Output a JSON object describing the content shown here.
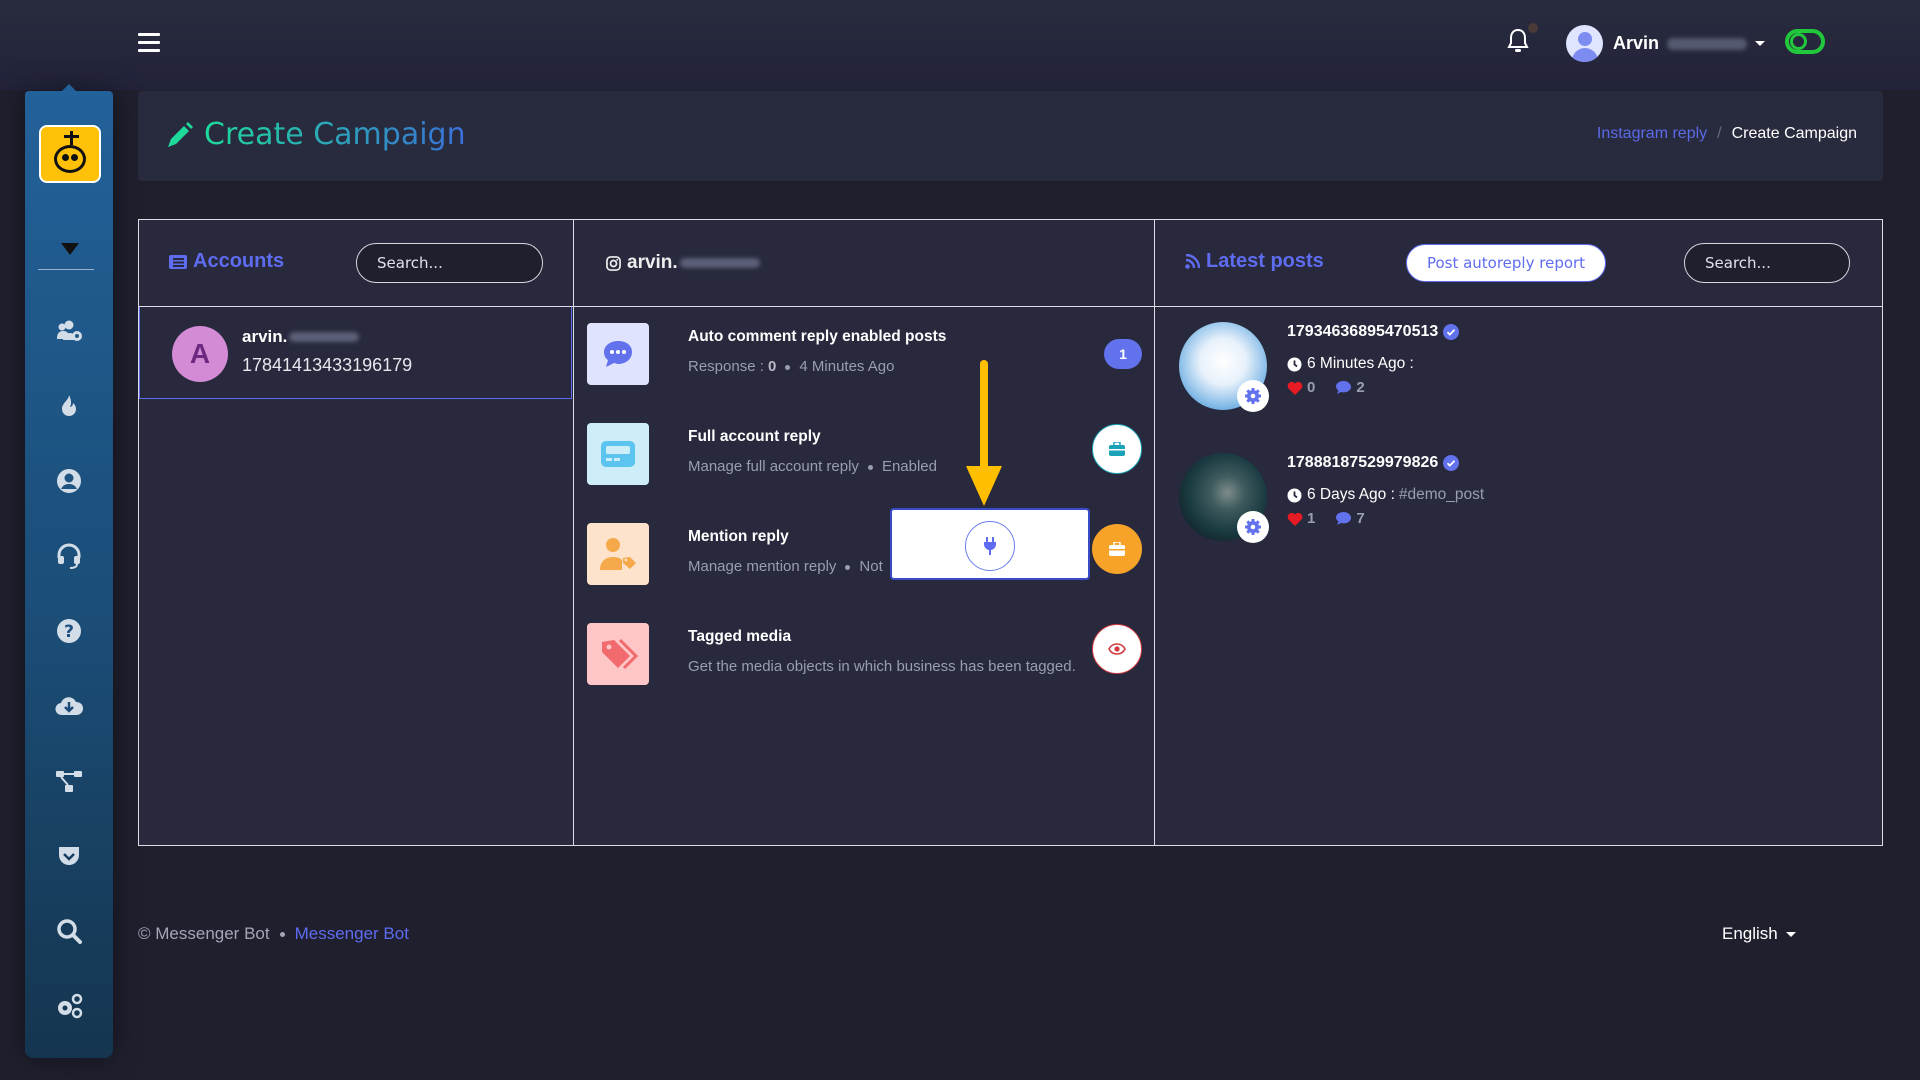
{
  "topbar": {
    "user_name": "Arvin",
    "toggle_state": "on"
  },
  "header": {
    "title": "Create Campaign",
    "breadcrumb": [
      {
        "label": "Instagram reply",
        "link": true
      },
      {
        "label": "Create Campaign",
        "link": false
      }
    ]
  },
  "sidebar": {
    "items": [
      {
        "icon": "users-cog-icon"
      },
      {
        "icon": "fire-icon"
      },
      {
        "icon": "user-circle-icon"
      },
      {
        "icon": "headset-icon"
      },
      {
        "icon": "question-circle-icon"
      },
      {
        "icon": "cloud-download-icon"
      },
      {
        "icon": "sitemap-icon"
      },
      {
        "icon": "pocket-icon"
      },
      {
        "icon": "search-icon"
      },
      {
        "icon": "cogs-icon"
      }
    ]
  },
  "accounts": {
    "title": "Accounts",
    "search_placeholder": "Search...",
    "items": [
      {
        "avatar_letter": "A",
        "name": "arvin.",
        "id": "17841413433196179"
      }
    ]
  },
  "account_detail": {
    "handle": "arvin.",
    "features": [
      {
        "title": "Auto comment reply enabled posts",
        "sub_prefix": "Response : ",
        "sub_value": "0",
        "sub_extra": "4 Minutes Ago",
        "badge": "1",
        "icon": "comment-dots-icon"
      },
      {
        "title": "Full account reply",
        "sub_prefix": "Manage full account reply",
        "sub_extra": "Enabled",
        "icon": "pager-icon",
        "action_icon": "briefcase-icon"
      },
      {
        "title": "Mention reply",
        "sub_prefix": "Manage mention reply",
        "sub_extra": "Not",
        "icon": "user-tag-icon",
        "action_icon": "briefcase-icon"
      },
      {
        "title": "Tagged media",
        "sub_prefix": "Get the media objects in which business has been tagged.",
        "icon": "tags-icon",
        "action_icon": "eye-icon"
      }
    ],
    "popup_icon": "plug-icon"
  },
  "latest_posts": {
    "title": "Latest posts",
    "report_button": "Post autoreply report",
    "search_placeholder": "Search...",
    "posts": [
      {
        "id": "17934636895470513",
        "time": "6 Minutes Ago",
        "caption": "",
        "likes": "0",
        "comments": "2"
      },
      {
        "id": "17888187529979826",
        "time": "6 Days Ago",
        "caption": "#demo_post",
        "likes": "1",
        "comments": "7"
      }
    ]
  },
  "footer": {
    "copyright": "© Messenger Bot",
    "link": "Messenger Bot",
    "language": "English"
  },
  "colors": {
    "accent": "#5e6cf0",
    "title_gradient_start": "#1ed99a",
    "title_gradient_end": "#3a6fd8",
    "toggle": "#22c83c",
    "arrow": "#ffbf00"
  }
}
